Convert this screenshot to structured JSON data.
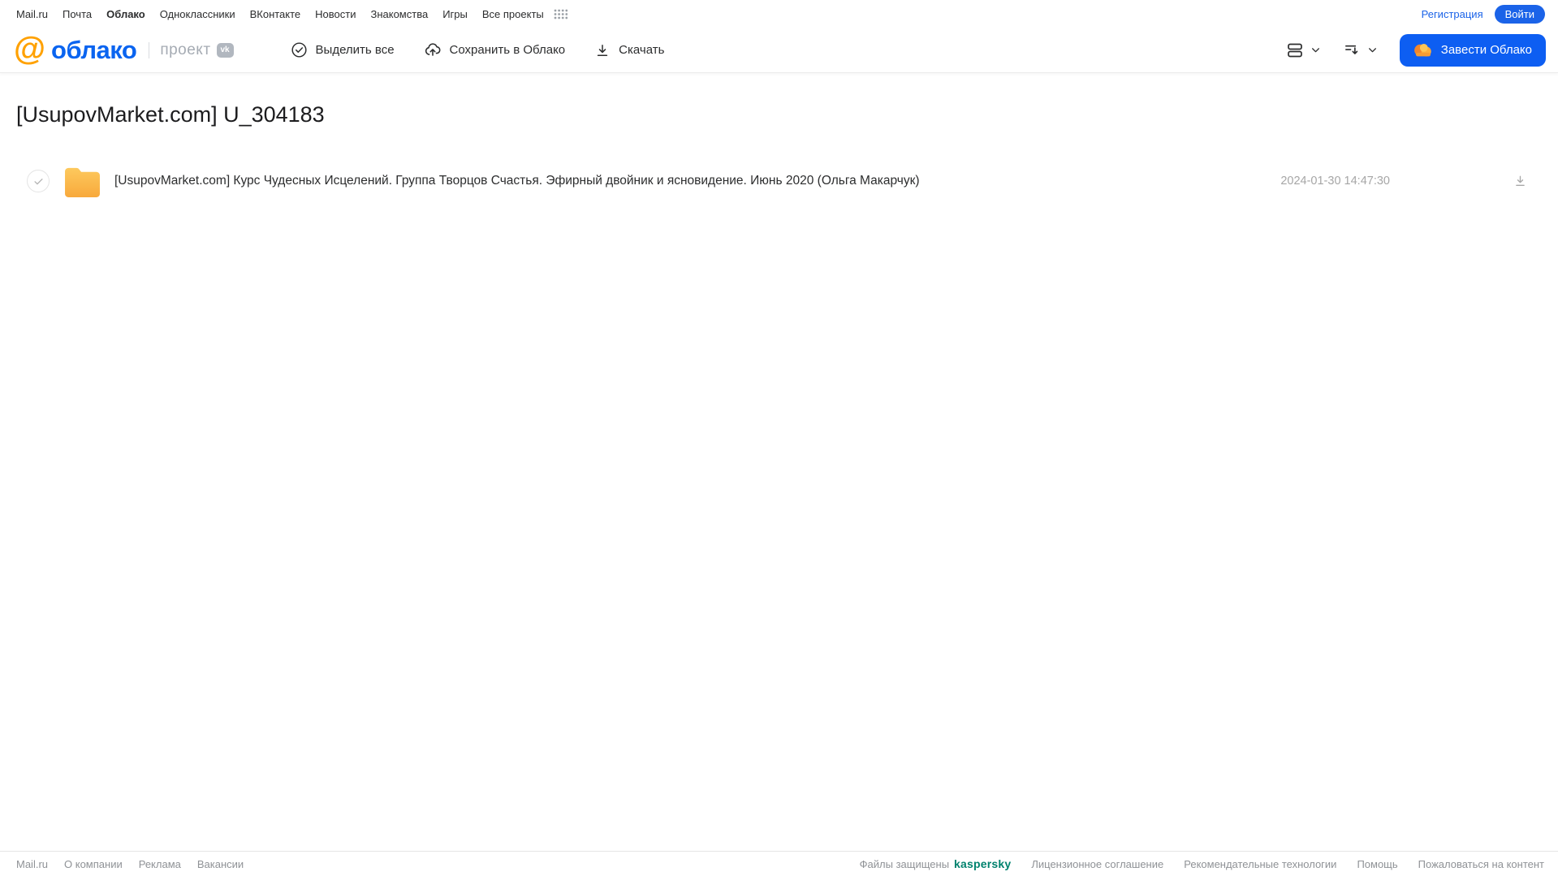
{
  "top_nav": {
    "links": [
      "Mail.ru",
      "Почта",
      "Облако",
      "Одноклассники",
      "ВКонтакте",
      "Новости",
      "Знакомства",
      "Игры",
      "Все проекты"
    ],
    "active_link": "Облако",
    "register_label": "Регистрация",
    "login_label": "Войти"
  },
  "header": {
    "logo_at": "@",
    "logo_text": "облако",
    "project_label": "проект",
    "vk_badge": "vk",
    "toolbar": {
      "select_all_label": "Выделить все",
      "save_to_cloud_label": "Сохранить в Облако",
      "download_label": "Скачать"
    },
    "get_cloud_label": "Завести Облако"
  },
  "page": {
    "title": "[UsupovMarket.com] U_304183"
  },
  "files": [
    {
      "type": "folder",
      "name": "[UsupovMarket.com] Курс Чудесных Исцелений. Группа Творцов Счастья. Эфирный двойник и ясновидение. Июнь 2020 (Ольга Макарчук)",
      "date": "2024-01-30 14:47:30"
    }
  ],
  "footer": {
    "left_links": [
      "Mail.ru",
      "О компании",
      "Реклама",
      "Вакансии"
    ],
    "protected_label": "Файлы защищены",
    "kaspersky_label": "kaspersky",
    "right_links": [
      "Лицензионное соглашение",
      "Рекомендательные технологии",
      "Помощь",
      "Пожаловаться на контент"
    ]
  },
  "colors": {
    "accent_blue": "#0d5ef2",
    "link_blue": "#1b63e8",
    "logo_blue": "#0a64f0",
    "logo_orange": "#ffa100",
    "folder_top": "#fdc95d",
    "folder_bottom": "#f8a93c",
    "kaspersky_green": "#00826e"
  }
}
